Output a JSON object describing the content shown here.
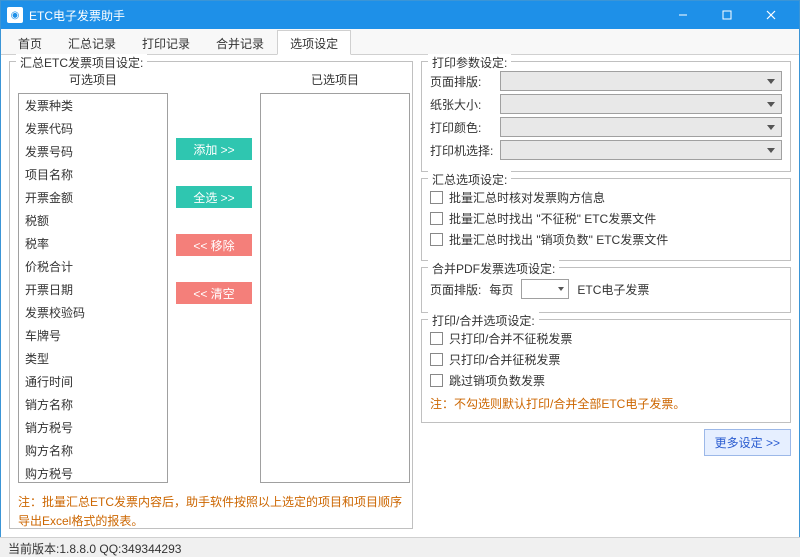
{
  "window": {
    "title": "ETC电子发票助手"
  },
  "tabs": {
    "items": [
      "首页",
      "汇总记录",
      "打印记录",
      "合并记录",
      "选项设定"
    ],
    "active_index": 4
  },
  "summary_project": {
    "legend": "汇总ETC发票项目设定:",
    "avail_header": "可选项目",
    "selected_header": "已选项目",
    "avail_items": [
      "发票种类",
      "发票代码",
      "发票号码",
      "项目名称",
      "开票金额",
      "税额",
      "税率",
      "价税合计",
      "开票日期",
      "发票校验码",
      "车牌号",
      "类型",
      "通行时间",
      "销方名称",
      "销方税号",
      "购方名称",
      "购方税号"
    ],
    "selected_items": [],
    "btn_add": "添加 >>",
    "btn_all": "全选 >>",
    "btn_remove": "<< 移除",
    "btn_clear": "<< 清空",
    "note": "注：批量汇总ETC发票内容后，助手软件按照以上选定的项目和项目顺序导出Excel格式的报表。"
  },
  "print_params": {
    "legend": "打印参数设定:",
    "rows": {
      "layout": "页面排版:",
      "paper": "纸张大小:",
      "color": "打印颜色:",
      "printer": "打印机选择:"
    }
  },
  "summary_opts": {
    "legend": "汇总选项设定:",
    "chk1": "批量汇总时核对发票购方信息",
    "chk2": "批量汇总时找出 \"不征税\" ETC发票文件",
    "chk3": "批量汇总时找出 \"销项负数\" ETC发票文件"
  },
  "merge_pdf": {
    "legend": "合并PDF发票选项设定:",
    "layout_label": "页面排版:",
    "perpage": "每页",
    "suffix": "ETC电子发票"
  },
  "print_merge": {
    "legend": "打印/合并选项设定:",
    "chk1": "只打印/合并不征税发票",
    "chk2": "只打印/合并征税发票",
    "chk3": "跳过销项负数发票",
    "note": "注：不勾选则默认打印/合并全部ETC电子发票。"
  },
  "more_btn": "更多设定 >>",
  "status": "当前版本:1.8.8.0   QQ:349344293"
}
